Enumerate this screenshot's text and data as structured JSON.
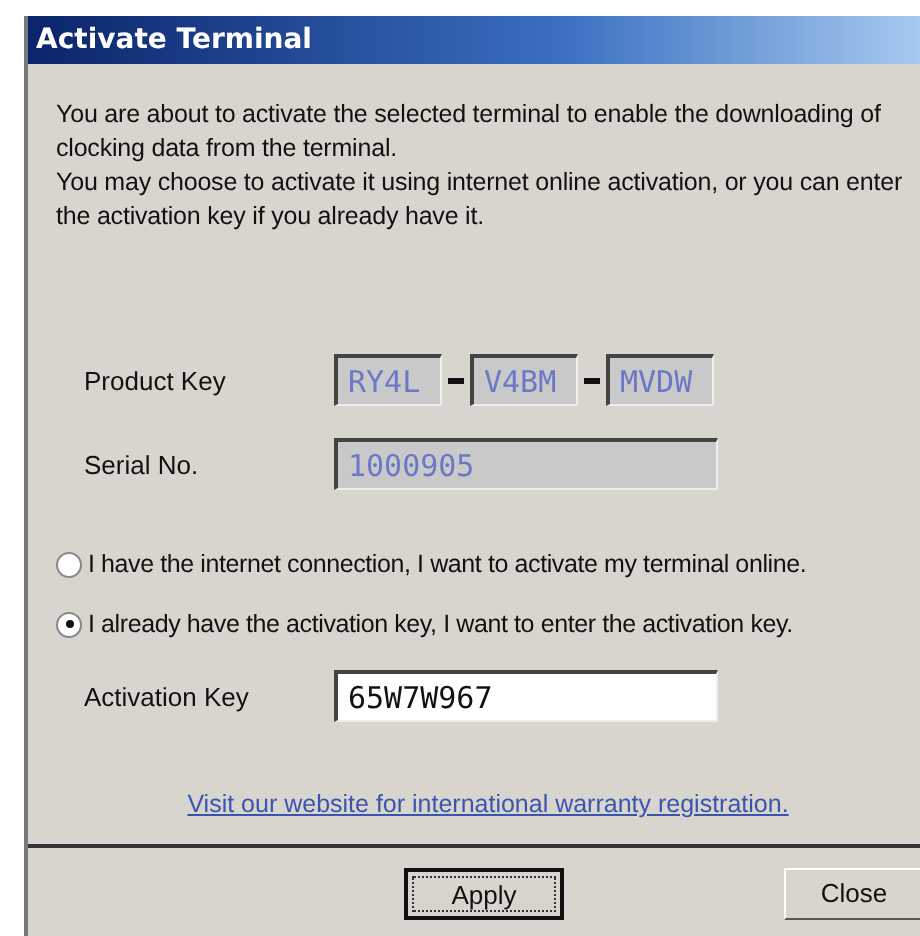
{
  "window": {
    "title": "Activate Terminal"
  },
  "intro": [
    "You are about to activate the selected terminal to enable the downloading of clocking data from the terminal.",
    "You may choose to activate it using internet online activation, or you can enter the activation key if you already have it."
  ],
  "product_key": {
    "label": "Product Key",
    "parts": [
      "RY4L",
      "V4BM",
      "MVDW"
    ]
  },
  "serial": {
    "label": "Serial No.",
    "value": "1000905"
  },
  "options": [
    {
      "label": "I have the internet connection, I want to activate my terminal online.",
      "selected": false
    },
    {
      "label": "I already have the activation key, I want to enter the activation key.",
      "selected": true
    }
  ],
  "activation_key": {
    "label": "Activation Key",
    "value": "65W7W967"
  },
  "link": "Visit our website for international warranty registration.",
  "buttons": [
    {
      "label": "Apply",
      "focused": true
    },
    {
      "label": "Close",
      "focused": false
    }
  ]
}
